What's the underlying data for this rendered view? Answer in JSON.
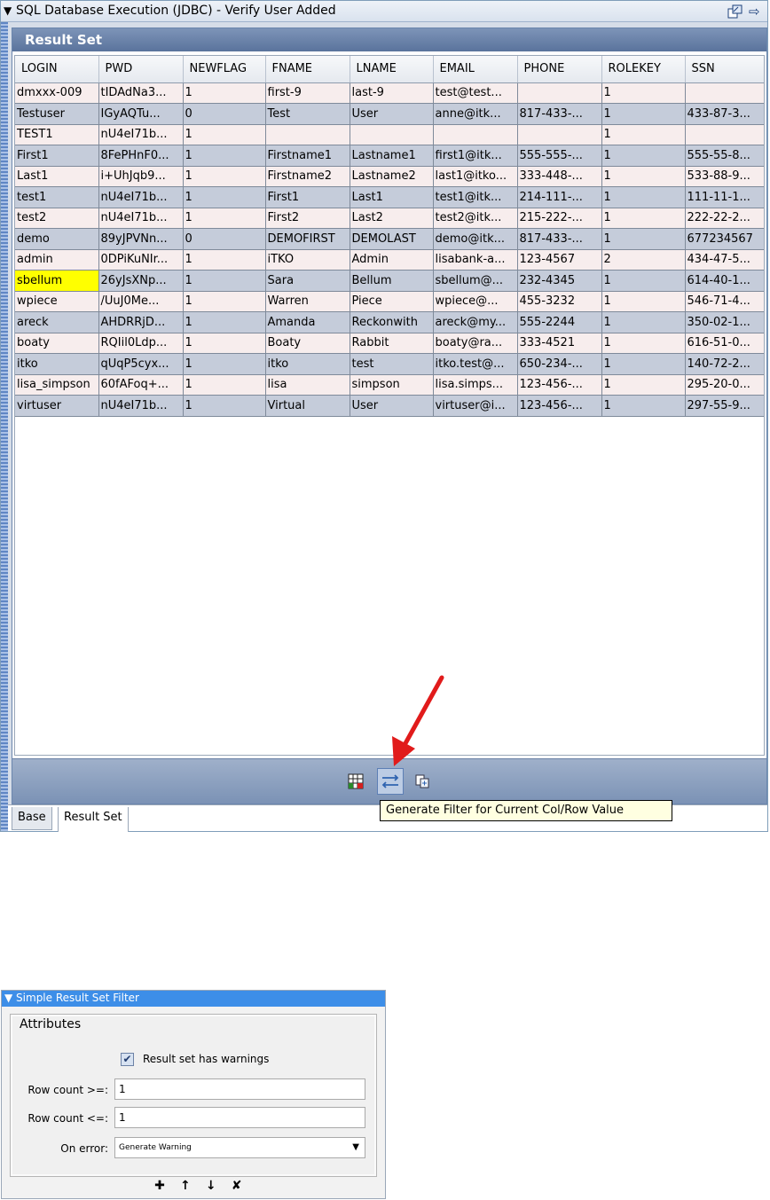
{
  "top_panel": {
    "title": "SQL Database Execution (JDBC) - Verify User Added",
    "result_set_header": "Result Set",
    "columns": [
      "LOGIN",
      "PWD",
      "NEWFLAG",
      "FNAME",
      "LNAME",
      "EMAIL",
      "PHONE",
      "ROLEKEY",
      "SSN"
    ],
    "rows": [
      [
        "dmxxx-009",
        "tIDAdNa3...",
        "1",
        "first-9",
        "last-9",
        "test@test...",
        "",
        "1",
        ""
      ],
      [
        "Testuser",
        "IGyAQTu...",
        "0",
        "Test",
        "User",
        "anne@itk...",
        "817-433-...",
        "1",
        "433-87-3..."
      ],
      [
        "TEST1",
        "nU4eI71b...",
        "1",
        "",
        "",
        "",
        "",
        "1",
        ""
      ],
      [
        "First1",
        "8FePHnF0...",
        "1",
        "Firstname1",
        "Lastname1",
        "first1@itk...",
        "555-555-...",
        "1",
        "555-55-8..."
      ],
      [
        "Last1",
        "i+UhJqb9...",
        "1",
        "Firstname2",
        "Lastname2",
        "last1@itko...",
        "333-448-...",
        "1",
        "533-88-9..."
      ],
      [
        "test1",
        "nU4eI71b...",
        "1",
        "First1",
        "Last1",
        "test1@itk...",
        "214-111-...",
        "1",
        "111-11-1..."
      ],
      [
        "test2",
        "nU4eI71b...",
        "1",
        "First2",
        "Last2",
        "test2@itk...",
        "215-222-...",
        "1",
        "222-22-2..."
      ],
      [
        "demo",
        "89yJPVNn...",
        "0",
        "DEMOFIRST",
        "DEMOLAST",
        "demo@itk...",
        "817-433-...",
        "1",
        "677234567"
      ],
      [
        "admin",
        "0DPiKuNIr...",
        "1",
        "iTKO",
        "Admin",
        "lisabank-a...",
        "123-4567",
        "2",
        "434-47-5..."
      ],
      [
        "sbellum",
        "26yJsXNp...",
        "1",
        "Sara",
        "Bellum",
        "sbellum@...",
        "232-4345",
        "1",
        "614-40-1..."
      ],
      [
        "wpiece",
        "/UuJ0Me...",
        "1",
        "Warren",
        "Piece",
        "wpiece@...",
        "455-3232",
        "1",
        "546-71-4..."
      ],
      [
        "areck",
        "AHDRRjD...",
        "1",
        "Amanda",
        "Reckonwith",
        "areck@my...",
        "555-2244",
        "1",
        "350-02-1..."
      ],
      [
        "boaty",
        "RQIil0Ldp...",
        "1",
        "Boaty",
        "Rabbit",
        "boaty@ra...",
        "333-4521",
        "1",
        "616-51-0..."
      ],
      [
        "itko",
        "qUqP5cyx...",
        "1",
        "itko",
        "test",
        "itko.test@...",
        "650-234-...",
        "1",
        "140-72-2..."
      ],
      [
        "lisa_simpson",
        "60fAFoq+...",
        "1",
        "lisa",
        "simpson",
        "lisa.simps...",
        "123-456-...",
        "1",
        "295-20-0..."
      ],
      [
        "virtuser",
        "nU4eI71b...",
        "1",
        "Virtual",
        "User",
        "virtuser@i...",
        "123-456-...",
        "1",
        "297-55-9..."
      ]
    ],
    "selected_cell": {
      "row": 9,
      "col": 0
    },
    "toolbar_icons": [
      "grid-icon",
      "generate-filter-icon",
      "copy-icon"
    ],
    "tooltip": "Generate Filter for Current Col/Row Value",
    "tabs": [
      "Base",
      "Result Set"
    ],
    "active_tab": "Result Set"
  },
  "bottom_panel": {
    "title": "Simple Result Set Filter",
    "group_label": "Attributes",
    "checkbox_label": "Result set has warnings",
    "checkbox_checked": true,
    "row_count_min_label": "Row count >=:",
    "row_count_min_value": "1",
    "row_count_max_label": "Row count <=:",
    "row_count_max_value": "1",
    "on_error_label": "On error:",
    "on_error_value": "Generate Warning",
    "buttons": {
      "add": "✚",
      "up": "↑",
      "down": "↓",
      "delete": "✘"
    }
  },
  "colors": {
    "selected_cell": "#ffff00",
    "annotation_arrow": "#e11b1b",
    "row_odd": "#f7eded",
    "row_even": "#c5ccda"
  }
}
